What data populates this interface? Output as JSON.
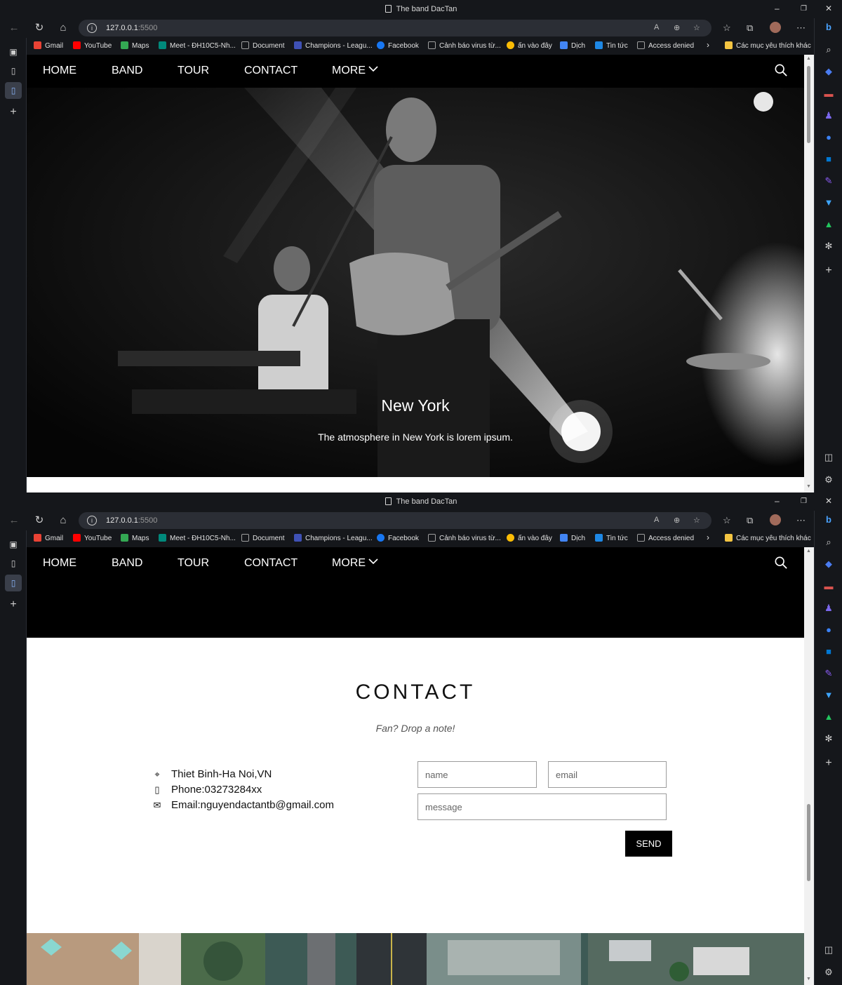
{
  "browser": {
    "window_title": "The band DacTan",
    "url_host": "127.0.0.1",
    "url_port": ":5500",
    "bookmarks": [
      {
        "label": "Gmail",
        "color": "#ea4335"
      },
      {
        "label": "YouTube",
        "color": "#ff0000"
      },
      {
        "label": "Maps",
        "color": "#34a853"
      },
      {
        "label": "Meet - ĐH10C5-Nh...",
        "color": "#00897b"
      },
      {
        "label": "Document",
        "color": "#9e9e9e"
      },
      {
        "label": "Champions - Leagu...",
        "color": "#3f51b5"
      },
      {
        "label": "Facebook",
        "color": "#1877f2"
      },
      {
        "label": "Cảnh báo virus từ...",
        "color": "#9e9e9e"
      },
      {
        "label": "ấn vào đây",
        "color": "#fbbc05"
      },
      {
        "label": "Dịch",
        "color": "#4285f4"
      },
      {
        "label": "Tin tức",
        "color": "#1e88e5"
      },
      {
        "label": "Access denied",
        "color": "#9e9e9e"
      }
    ],
    "other_bookmarks": "Các mục yêu thích khác"
  },
  "site_nav": {
    "home": "HOME",
    "band": "BAND",
    "tour": "TOUR",
    "contact": "CONTACT",
    "more": "MORE"
  },
  "hero": {
    "title": "New York",
    "subtitle": "The atmosphere in New York is lorem ipsum."
  },
  "contact": {
    "heading": "CONTACT",
    "tagline": "Fan? Drop a note!",
    "address": "Thiet Binh-Ha Noi,VN",
    "phone": "Phone:03273284xx",
    "email": "Email:nguyendactantb@gmail.com",
    "name_placeholder": "name",
    "email_placeholder": "email",
    "message_placeholder": "message",
    "send_label": "SEND"
  }
}
